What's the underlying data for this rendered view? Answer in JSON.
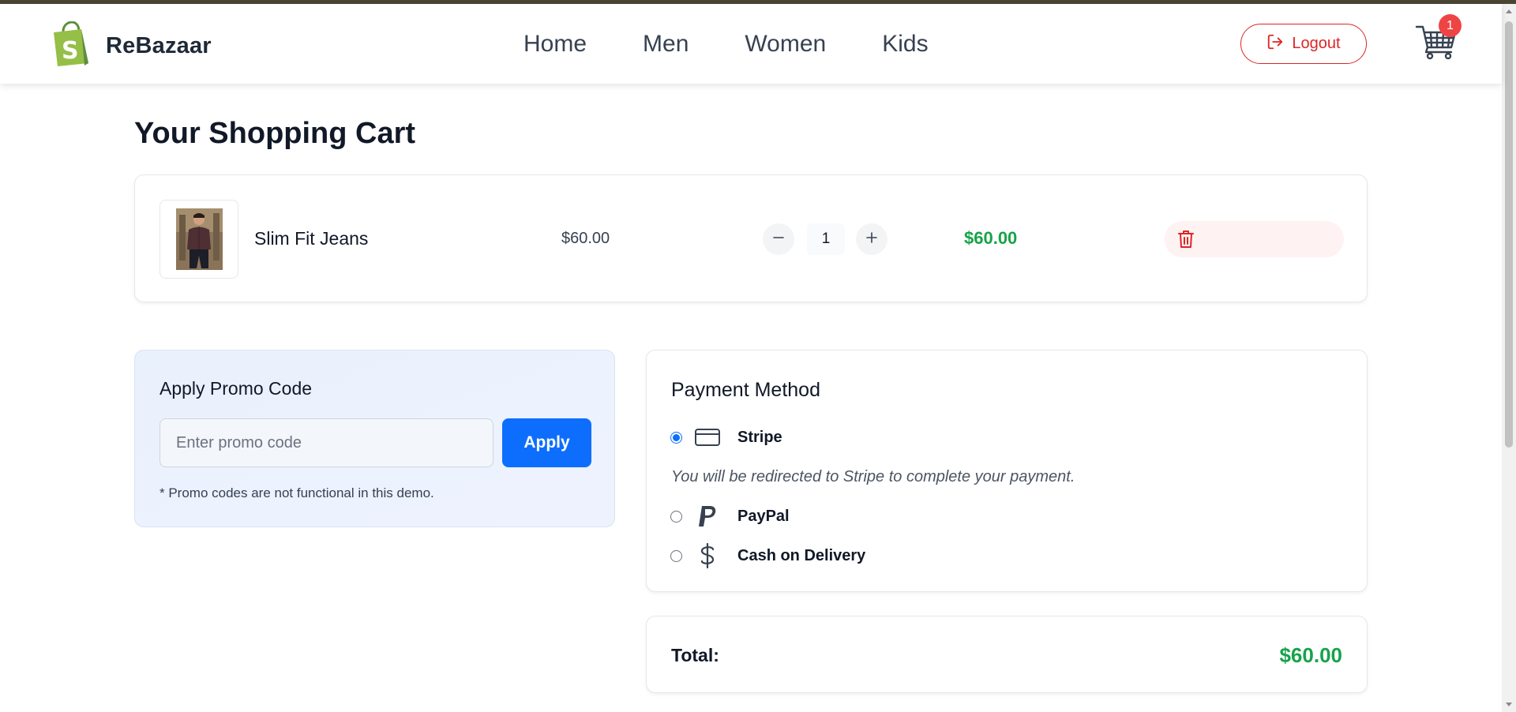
{
  "brand": {
    "name": "ReBazaar",
    "logo_icon": "shopify-bag-icon",
    "color": "#95bf47"
  },
  "nav": {
    "links": [
      {
        "label": "Home"
      },
      {
        "label": "Men"
      },
      {
        "label": "Women"
      },
      {
        "label": "Kids"
      }
    ],
    "logout_label": "Logout",
    "cart_count": "1"
  },
  "cart": {
    "title": "Your Shopping Cart",
    "items": [
      {
        "name": "Slim Fit Jeans",
        "price": "$60.00",
        "quantity": "1",
        "subtotal": "$60.00"
      }
    ]
  },
  "promo": {
    "title": "Apply Promo Code",
    "placeholder": "Enter promo code",
    "value": "",
    "apply_label": "Apply",
    "note": "* Promo codes are not functional in this demo."
  },
  "payment": {
    "title": "Payment Method",
    "options": [
      {
        "label": "Stripe",
        "icon": "credit-card-icon",
        "selected": true
      },
      {
        "label": "PayPal",
        "icon": "paypal-icon",
        "selected": false
      },
      {
        "label": "Cash on Delivery",
        "icon": "dollar-icon",
        "selected": false
      }
    ],
    "stripe_note": "You will be redirected to Stripe to complete your payment."
  },
  "summary": {
    "total_label": "Total:",
    "total_value": "$60.00"
  },
  "colors": {
    "accent": "#0d6efd",
    "success": "#16a34a",
    "danger": "#dc2626",
    "badge": "#ef4444"
  }
}
